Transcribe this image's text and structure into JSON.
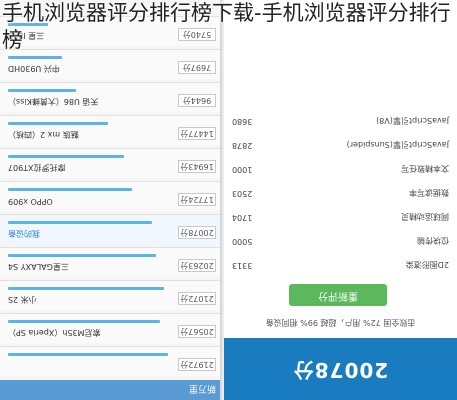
{
  "title": "手机浏览器评分排行榜下载-手机浏览器评分排行榜",
  "left_phone": {
    "top_bar_text": "新万里",
    "rows": [
      {
        "score": "21972分",
        "device": "",
        "bar": 0.8
      },
      {
        "score": "20567分",
        "device": "索尼M35h（Xperia SP）",
        "bar": 0.76
      },
      {
        "score": "21072分",
        "device": "小米 2S",
        "bar": 0.78
      },
      {
        "score": "20263分",
        "device": "三星GALAXY S4",
        "bar": 0.74
      },
      {
        "score": "20078分",
        "device": "我的设备",
        "bar": 0.72,
        "highlight": true
      },
      {
        "score": "17724分",
        "device": "OPPO x909",
        "bar": 0.62
      },
      {
        "score": "16943分",
        "device": "摩托罗拉XT907",
        "bar": 0.58
      },
      {
        "score": "14477分",
        "device": "魅族 mx 2（四核）",
        "bar": 0.5
      },
      {
        "score": "9644分",
        "device": "天语 U86（大黄蜂Kiss）",
        "bar": 0.34
      },
      {
        "score": "7697分",
        "device": "中兴 U930HD",
        "bar": 0.27
      },
      {
        "score": "5740分",
        "device": "三星 I829",
        "bar": 0.2
      }
    ]
  },
  "right_phone": {
    "score": "20078分",
    "stats_line": "击败全国 72% 用户，超越 99% 相同设备",
    "rescore_button": "重新评分",
    "details": [
      {
        "name": "2D图形渲染",
        "value": "3313"
      },
      {
        "name": "位块传输",
        "value": "5000"
      },
      {
        "name": "网球运动精灵",
        "value": "1704"
      },
      {
        "name": "数据读写率",
        "value": "2503"
      },
      {
        "name": "文本精致任写",
        "value": "1000"
      },
      {
        "name": "JavaScript引擎(Sunspider)",
        "value": "2878"
      },
      {
        "name": "JavaScript引擎(V8)",
        "value": "3680"
      }
    ]
  },
  "colors": {
    "accent_blue": "#1a7cc0",
    "bar_blue": "#5cb3e8",
    "button_green": "#5cb85c"
  }
}
